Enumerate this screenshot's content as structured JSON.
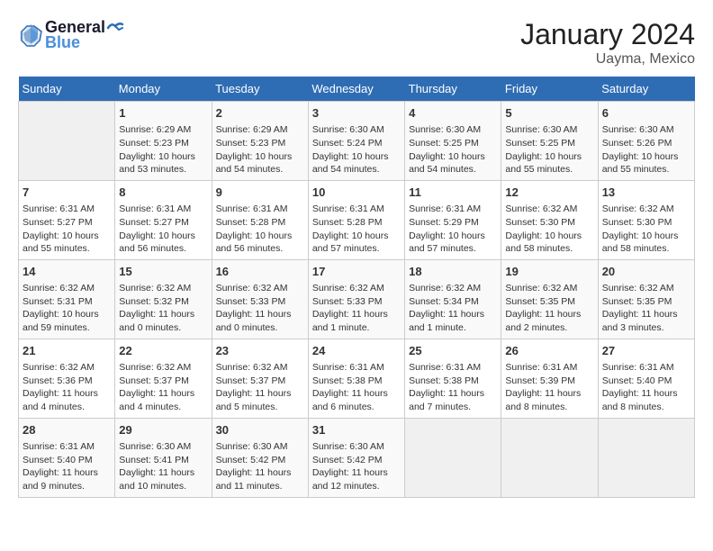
{
  "header": {
    "logo_line1": "General",
    "logo_line2": "Blue",
    "month": "January 2024",
    "location": "Uayma, Mexico"
  },
  "days_of_week": [
    "Sunday",
    "Monday",
    "Tuesday",
    "Wednesday",
    "Thursday",
    "Friday",
    "Saturday"
  ],
  "weeks": [
    [
      {
        "day": "",
        "info": ""
      },
      {
        "day": "1",
        "info": "Sunrise: 6:29 AM\nSunset: 5:23 PM\nDaylight: 10 hours\nand 53 minutes."
      },
      {
        "day": "2",
        "info": "Sunrise: 6:29 AM\nSunset: 5:23 PM\nDaylight: 10 hours\nand 54 minutes."
      },
      {
        "day": "3",
        "info": "Sunrise: 6:30 AM\nSunset: 5:24 PM\nDaylight: 10 hours\nand 54 minutes."
      },
      {
        "day": "4",
        "info": "Sunrise: 6:30 AM\nSunset: 5:25 PM\nDaylight: 10 hours\nand 54 minutes."
      },
      {
        "day": "5",
        "info": "Sunrise: 6:30 AM\nSunset: 5:25 PM\nDaylight: 10 hours\nand 55 minutes."
      },
      {
        "day": "6",
        "info": "Sunrise: 6:30 AM\nSunset: 5:26 PM\nDaylight: 10 hours\nand 55 minutes."
      }
    ],
    [
      {
        "day": "7",
        "info": "Sunrise: 6:31 AM\nSunset: 5:27 PM\nDaylight: 10 hours\nand 55 minutes."
      },
      {
        "day": "8",
        "info": "Sunrise: 6:31 AM\nSunset: 5:27 PM\nDaylight: 10 hours\nand 56 minutes."
      },
      {
        "day": "9",
        "info": "Sunrise: 6:31 AM\nSunset: 5:28 PM\nDaylight: 10 hours\nand 56 minutes."
      },
      {
        "day": "10",
        "info": "Sunrise: 6:31 AM\nSunset: 5:28 PM\nDaylight: 10 hours\nand 57 minutes."
      },
      {
        "day": "11",
        "info": "Sunrise: 6:31 AM\nSunset: 5:29 PM\nDaylight: 10 hours\nand 57 minutes."
      },
      {
        "day": "12",
        "info": "Sunrise: 6:32 AM\nSunset: 5:30 PM\nDaylight: 10 hours\nand 58 minutes."
      },
      {
        "day": "13",
        "info": "Sunrise: 6:32 AM\nSunset: 5:30 PM\nDaylight: 10 hours\nand 58 minutes."
      }
    ],
    [
      {
        "day": "14",
        "info": "Sunrise: 6:32 AM\nSunset: 5:31 PM\nDaylight: 10 hours\nand 59 minutes."
      },
      {
        "day": "15",
        "info": "Sunrise: 6:32 AM\nSunset: 5:32 PM\nDaylight: 11 hours\nand 0 minutes."
      },
      {
        "day": "16",
        "info": "Sunrise: 6:32 AM\nSunset: 5:33 PM\nDaylight: 11 hours\nand 0 minutes."
      },
      {
        "day": "17",
        "info": "Sunrise: 6:32 AM\nSunset: 5:33 PM\nDaylight: 11 hours\nand 1 minute."
      },
      {
        "day": "18",
        "info": "Sunrise: 6:32 AM\nSunset: 5:34 PM\nDaylight: 11 hours\nand 1 minute."
      },
      {
        "day": "19",
        "info": "Sunrise: 6:32 AM\nSunset: 5:35 PM\nDaylight: 11 hours\nand 2 minutes."
      },
      {
        "day": "20",
        "info": "Sunrise: 6:32 AM\nSunset: 5:35 PM\nDaylight: 11 hours\nand 3 minutes."
      }
    ],
    [
      {
        "day": "21",
        "info": "Sunrise: 6:32 AM\nSunset: 5:36 PM\nDaylight: 11 hours\nand 4 minutes."
      },
      {
        "day": "22",
        "info": "Sunrise: 6:32 AM\nSunset: 5:37 PM\nDaylight: 11 hours\nand 4 minutes."
      },
      {
        "day": "23",
        "info": "Sunrise: 6:32 AM\nSunset: 5:37 PM\nDaylight: 11 hours\nand 5 minutes."
      },
      {
        "day": "24",
        "info": "Sunrise: 6:31 AM\nSunset: 5:38 PM\nDaylight: 11 hours\nand 6 minutes."
      },
      {
        "day": "25",
        "info": "Sunrise: 6:31 AM\nSunset: 5:38 PM\nDaylight: 11 hours\nand 7 minutes."
      },
      {
        "day": "26",
        "info": "Sunrise: 6:31 AM\nSunset: 5:39 PM\nDaylight: 11 hours\nand 8 minutes."
      },
      {
        "day": "27",
        "info": "Sunrise: 6:31 AM\nSunset: 5:40 PM\nDaylight: 11 hours\nand 8 minutes."
      }
    ],
    [
      {
        "day": "28",
        "info": "Sunrise: 6:31 AM\nSunset: 5:40 PM\nDaylight: 11 hours\nand 9 minutes."
      },
      {
        "day": "29",
        "info": "Sunrise: 6:30 AM\nSunset: 5:41 PM\nDaylight: 11 hours\nand 10 minutes."
      },
      {
        "day": "30",
        "info": "Sunrise: 6:30 AM\nSunset: 5:42 PM\nDaylight: 11 hours\nand 11 minutes."
      },
      {
        "day": "31",
        "info": "Sunrise: 6:30 AM\nSunset: 5:42 PM\nDaylight: 11 hours\nand 12 minutes."
      },
      {
        "day": "",
        "info": ""
      },
      {
        "day": "",
        "info": ""
      },
      {
        "day": "",
        "info": ""
      }
    ]
  ]
}
